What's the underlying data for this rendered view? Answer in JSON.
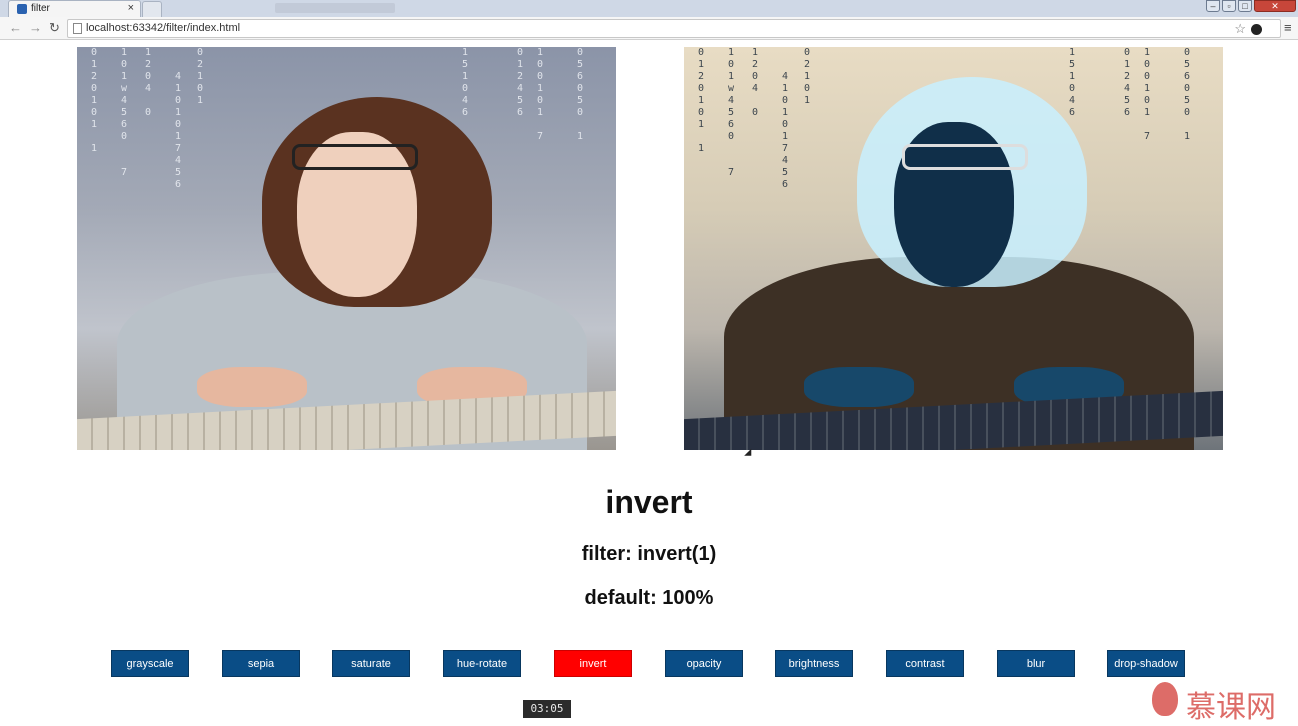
{
  "browser": {
    "tab_title": "filter",
    "tab_close": "×",
    "url": "localhost:63342/filter/index.html",
    "icons": {
      "back": "back-arrow-icon",
      "forward": "forward-arrow-icon",
      "reload": "reload-icon",
      "star": "star-icon",
      "menu": "menu-icon"
    }
  },
  "demo": {
    "filter_name": "invert",
    "filter_css": "filter: invert(1)",
    "default_text": "default: 100%"
  },
  "buttons": [
    {
      "label": "grayscale",
      "active": false
    },
    {
      "label": "sepia",
      "active": false
    },
    {
      "label": "saturate",
      "active": false
    },
    {
      "label": "hue-rotate",
      "active": false
    },
    {
      "label": "invert",
      "active": true
    },
    {
      "label": "opacity",
      "active": false
    },
    {
      "label": "brightness",
      "active": false
    },
    {
      "label": "contrast",
      "active": false
    },
    {
      "label": "blur",
      "active": false
    },
    {
      "label": "drop-shadow",
      "active": false
    }
  ],
  "colors": {
    "button_bg": "#0a4d86",
    "button_active_bg": "#ff0000"
  },
  "video": {
    "timestamp": "03:05"
  },
  "watermark": {
    "text": "慕课网"
  }
}
